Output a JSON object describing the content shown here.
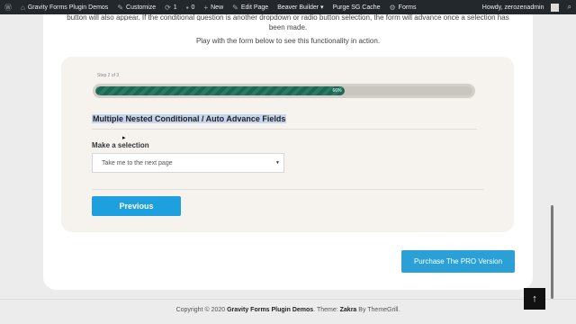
{
  "adminbar": {
    "items": [
      {
        "icon": "wordpress-icon",
        "glyph": "Ⓦ",
        "label": ""
      },
      {
        "icon": "home-icon",
        "glyph": "⌂",
        "label": "Gravity Forms Plugin Demos"
      },
      {
        "icon": "brush-icon",
        "glyph": "✎",
        "label": "Customize"
      },
      {
        "icon": "refresh-icon",
        "glyph": "⟳",
        "label": "1"
      },
      {
        "icon": "comment-icon",
        "glyph": "▪",
        "label": "0"
      },
      {
        "icon": "plus-icon",
        "glyph": "+",
        "label": "New"
      },
      {
        "icon": "pencil-icon",
        "glyph": "✎",
        "label": "Edit Page"
      },
      {
        "icon": "",
        "glyph": "",
        "label": "Beaver Builder ▾"
      },
      {
        "icon": "",
        "glyph": "",
        "label": "Purge SG Cache"
      },
      {
        "icon": "forms-icon",
        "glyph": "⚙",
        "label": "Forms"
      }
    ],
    "greeting": "Howdy, zerozenadmin",
    "search_icon": "search-icon"
  },
  "intro": {
    "line1": "button will also appear. If the conditional question is another dropdown or radio button selection, the form will advance once a selection has",
    "line2": "been made.",
    "line3": "Play with the form below to see this functionality in action."
  },
  "form": {
    "step_label": "Step 2 of 3",
    "progress": 66,
    "progress_label": "66%",
    "title": "Multiple Nested Conditional / Auto Advance Fields",
    "field_label": "Make a selection",
    "select_value": "Take me to the next page",
    "previous_label": "Previous"
  },
  "cta": {
    "label": "Purchase The PRO Version"
  },
  "footer": {
    "prefix": "Copyright © 2020 ",
    "site": "Gravity Forms Plugin Demos",
    "middle": ". Theme: ",
    "theme": "Zakra",
    "by": " By ThemeGrill."
  },
  "to_top_icon": "arrow-up-icon",
  "colors": {
    "accent": "#1e9fde",
    "progress": "#2a7a66",
    "adminbar": "#23282d"
  }
}
